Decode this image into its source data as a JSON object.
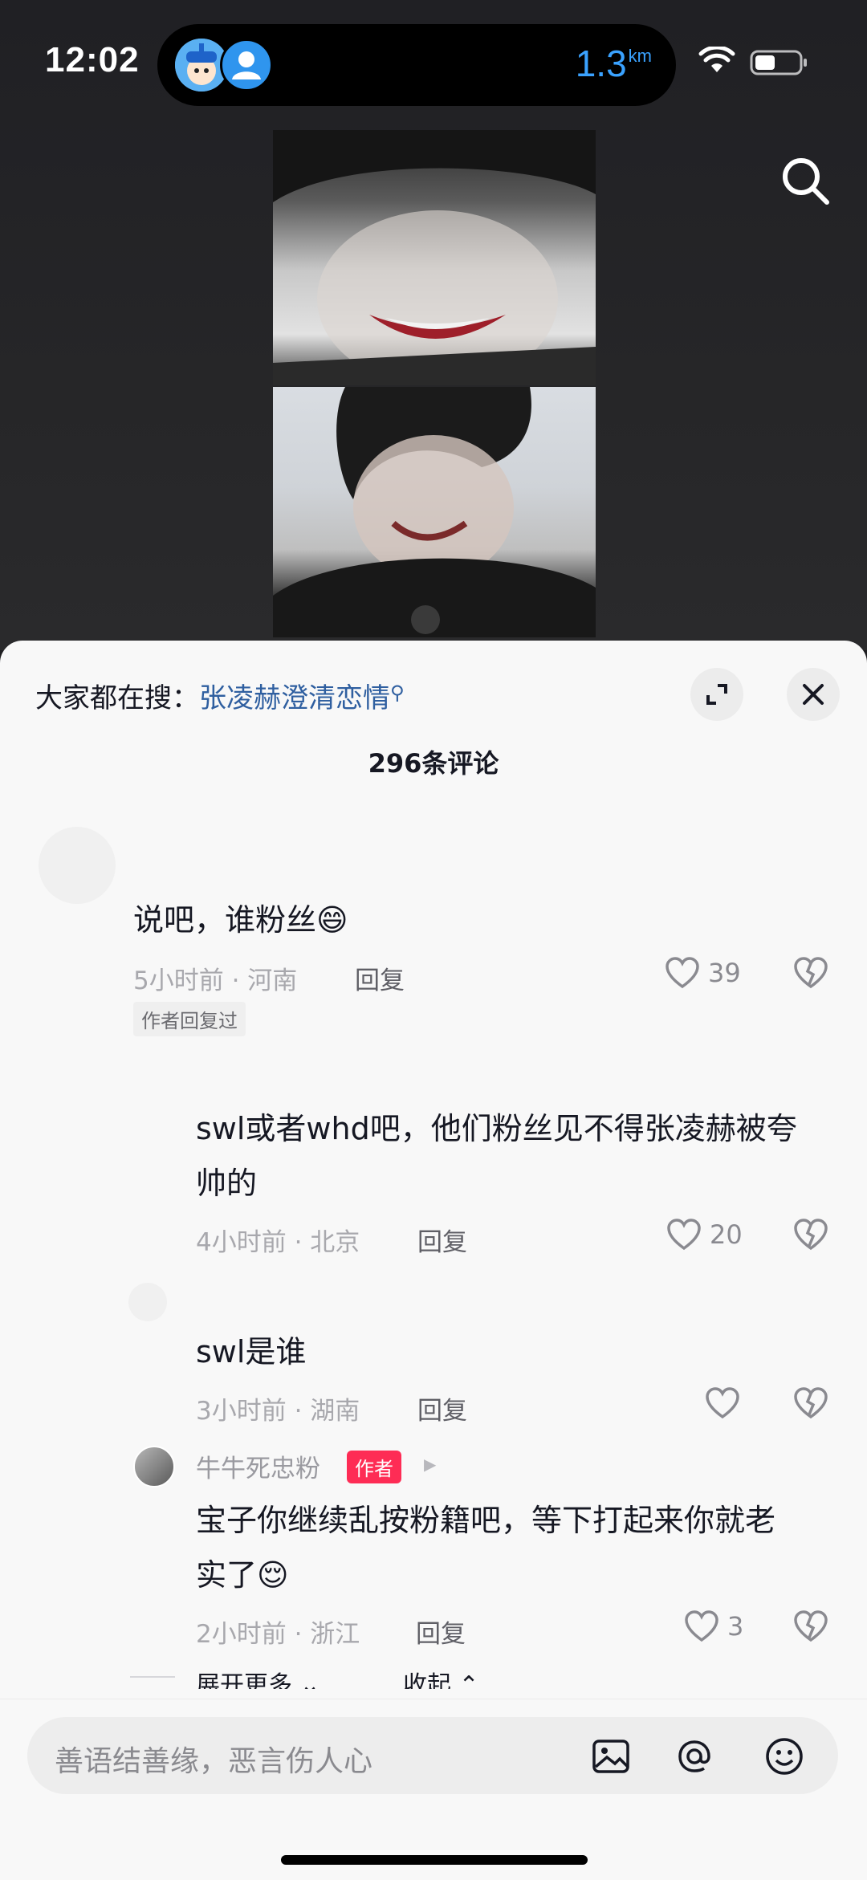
{
  "status_bar": {
    "time": "12:02",
    "distance": "1.3",
    "distance_unit": "km"
  },
  "video": {
    "search_icon": "search-icon"
  },
  "panel": {
    "search_hint_prefix": "大家都在搜：",
    "search_hint_term": "张凌赫澄清恋情",
    "comment_count": "296条评论"
  },
  "comments": [
    {
      "text": "说吧，谁粉丝😄",
      "time": "5小时前",
      "location": "河南",
      "reply_label": "回复",
      "likes": "39",
      "tag": "作者回复过"
    },
    {
      "text_line1": "swl或者whd吧，他们粉丝见不得张凌赫被夸",
      "text_line2": "帅的",
      "time": "4小时前",
      "location": "北京",
      "reply_label": "回复",
      "likes": "20"
    },
    {
      "text": "swl是谁",
      "time": "3小时前",
      "location": "湖南",
      "reply_label": "回复",
      "likes": ""
    },
    {
      "name": "牛牛死忠粉",
      "badge": "作者",
      "text_line1": "宝子你继续乱按粉籍吧，等下打起来你就老",
      "text_line2": "实了😌",
      "time": "2小时前",
      "location": "浙江",
      "reply_label": "回复",
      "likes": "3"
    }
  ],
  "thread_controls": {
    "expand_more": "展开更多",
    "collapse": "收起"
  },
  "input": {
    "placeholder": "善语结善缘，恶言伤人心"
  },
  "colors": {
    "accent_link": "#2f5fa0",
    "author_badge": "#fe2c55",
    "island_text": "#3aa2ff"
  }
}
